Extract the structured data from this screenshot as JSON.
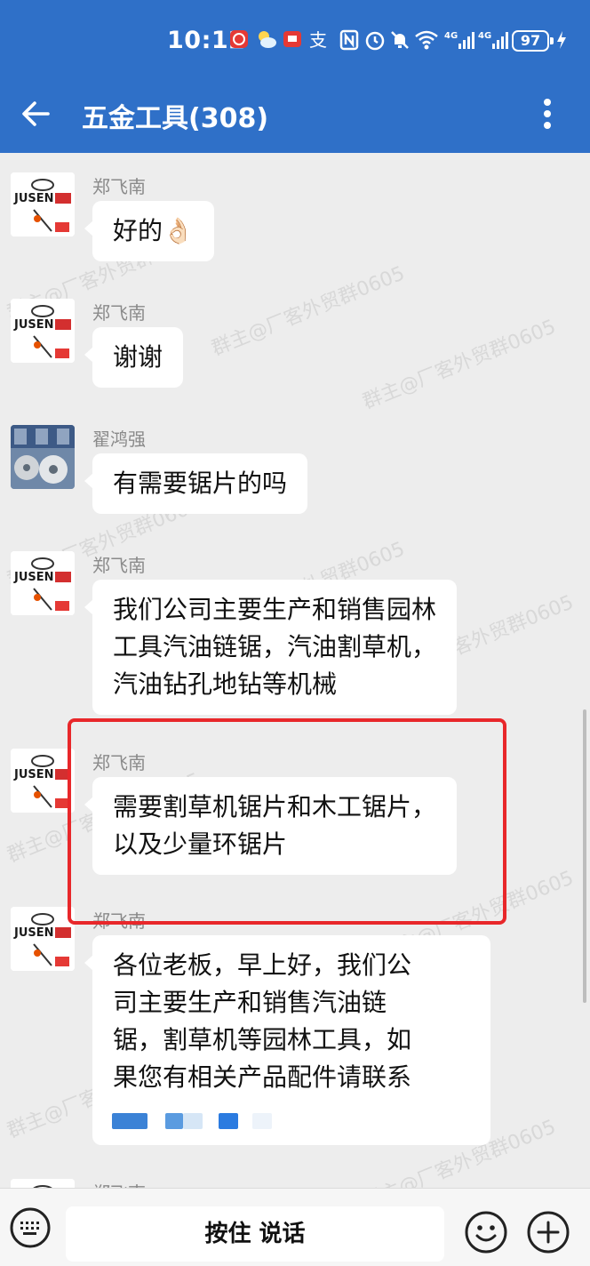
{
  "status_bar": {
    "time": "10:12",
    "battery": "97",
    "net1": "4G",
    "net2": "4G"
  },
  "header": {
    "title": "五金工具(308)"
  },
  "avatars": {
    "brand_text": "JUSEN巨森"
  },
  "messages": [
    {
      "sender": "郑飞南",
      "text": "好的👌🏻"
    },
    {
      "sender": "郑飞南",
      "text": "谢谢"
    },
    {
      "sender": "翟鸿强",
      "text": "有需要锯片的吗"
    },
    {
      "sender": "郑飞南",
      "lines": [
        "我们公司主要生产和销售园林",
        "工具汽油链锯，汽油割草机，",
        "汽油钻孔地钻等机械"
      ]
    },
    {
      "sender": "郑飞南",
      "lines": [
        "需要割草机锯片和木工锯片，",
        "以及少量环锯片"
      ]
    },
    {
      "sender": "郑飞南",
      "lines": [
        "各位老板，早上好，我们公",
        "司主要生产和销售汽油链",
        "锯，割草机等园林工具，如",
        "果您有相关产品配件请联系"
      ]
    },
    {
      "sender": "郑飞南"
    }
  ],
  "watermark": "群主@厂客外贸群0605",
  "input_bar": {
    "voice_label": "按住 说话"
  },
  "colors": {
    "header_bg": "#2f70c8",
    "highlight": "#e8272a",
    "chat_bg": "#ededed"
  }
}
